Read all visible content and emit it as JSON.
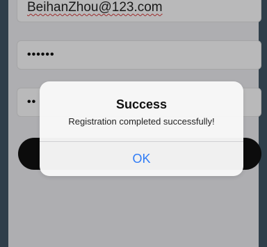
{
  "form": {
    "email_value": "BeihanZhou@123.com",
    "password_value": "••••••",
    "confirm_password_value": "••"
  },
  "alert": {
    "title": "Success",
    "message": "Registration completed successfully!",
    "ok_label": "OK"
  },
  "colors": {
    "outer_background": "#3f5363",
    "screen_background": "#e9e9ec",
    "button_background": "#111111",
    "alert_button_text": "#2f7cf6"
  }
}
